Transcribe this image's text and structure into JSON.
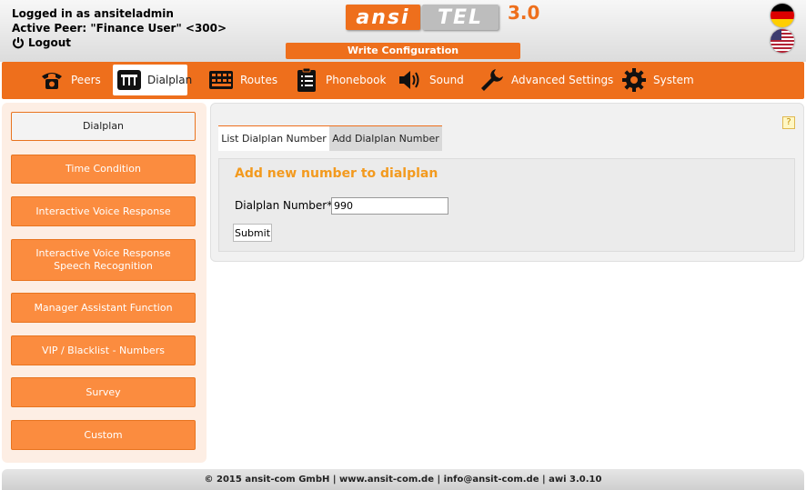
{
  "header": {
    "logged_in_text": "Logged in as ansiteladmin",
    "active_peer_text": "Active Peer: \"Finance User\" <300>",
    "logout_label": "Logout",
    "logo_part1": "ansi",
    "logo_part2": "TEL",
    "logo_version": "3.0",
    "write_config_label": "Write Configuration",
    "flags": [
      "german-flag-icon",
      "us-flag-icon"
    ]
  },
  "nav": {
    "items": [
      {
        "label": "Peers",
        "icon": "phone-icon"
      },
      {
        "label": "Dialplan",
        "icon": "dialplan-icon",
        "active": true
      },
      {
        "label": "Routes",
        "icon": "routes-icon"
      },
      {
        "label": "Phonebook",
        "icon": "phonebook-icon"
      },
      {
        "label": "Sound",
        "icon": "speaker-icon"
      },
      {
        "label": "Advanced Settings",
        "icon": "wrench-icon"
      },
      {
        "label": "System",
        "icon": "gear-icon"
      }
    ]
  },
  "sidebar": {
    "items": [
      {
        "label": "Dialplan",
        "active": true
      },
      {
        "label": "Time Condition"
      },
      {
        "label": "Interactive Voice Response"
      },
      {
        "label": "Interactive Voice Response Speech Recognition"
      },
      {
        "label": "Manager Assistant Function"
      },
      {
        "label": "VIP / Blacklist - Numbers"
      },
      {
        "label": "Survey"
      },
      {
        "label": "Custom"
      }
    ]
  },
  "main": {
    "help_label": "?",
    "tabs": [
      {
        "label": "List Dialplan Number"
      },
      {
        "label": "Add Dialplan Number",
        "active": true
      }
    ],
    "form": {
      "title": "Add new number to dialplan",
      "field_label": "Dialplan Number*",
      "field_value": "990",
      "submit_label": "Submit"
    }
  },
  "footer": {
    "text": "© 2015 ansit-com GmbH | www.ansit-com.de | info@ansit-com.de | awi 3.0.10"
  },
  "colors": {
    "accent": "#ee6f1c",
    "sidebar_button": "#fb8c3f",
    "title": "#f39a1e"
  }
}
